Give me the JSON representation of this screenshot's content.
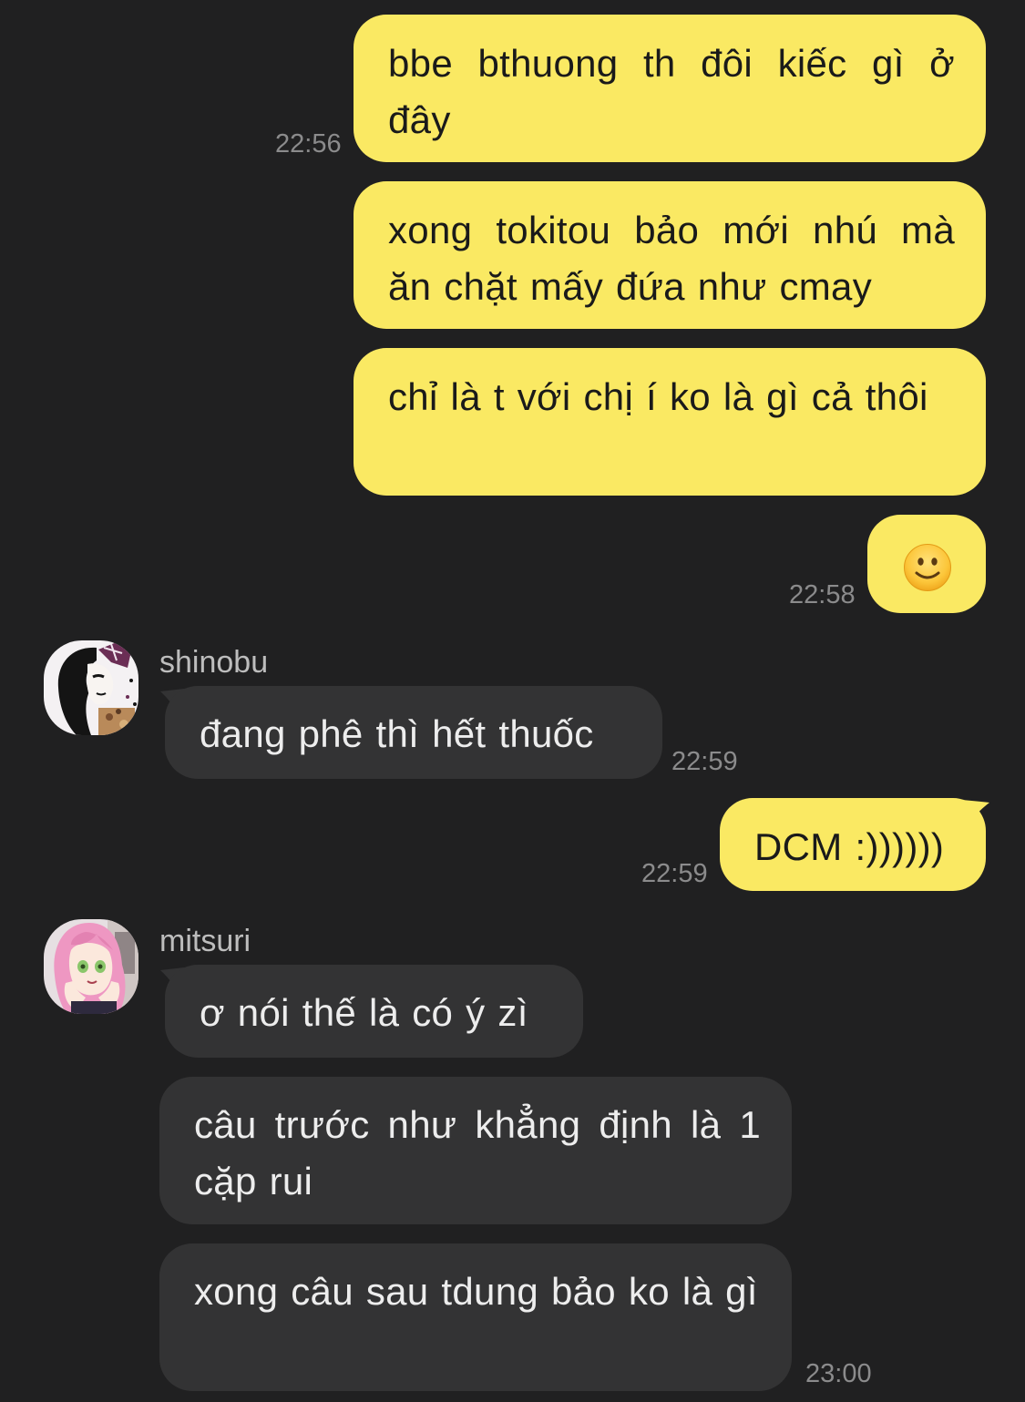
{
  "messages": [
    {
      "id": "m1",
      "text": "bbe bthuong th đôi kiếc gì ở đây",
      "time": "22:56"
    },
    {
      "id": "m2",
      "text": "xong tokitou bảo mới nhú mà ăn chặt mấy đứa như cmay"
    },
    {
      "id": "m3",
      "text": "chỉ là t với chị í ko là gì cả thôi"
    },
    {
      "id": "m4",
      "emoji": "slightly-smiling-face",
      "time": "22:58"
    },
    {
      "id": "m5",
      "sender": "shinobu",
      "text": "đang phê thì hết thuốc",
      "time": "22:59"
    },
    {
      "id": "m6",
      "text": "DCM :))))))",
      "time": "22:59"
    },
    {
      "id": "m7",
      "sender": "mitsuri",
      "text": "ơ nói thế là có ý zì"
    },
    {
      "id": "m8",
      "text": "câu trước như khẳng định là 1 cặp rui"
    },
    {
      "id": "m9",
      "text": "xong câu sau tdung bảo ko là gì",
      "time": "23:00"
    }
  ],
  "colors": {
    "background": "#202021",
    "outgoing_bubble": "#fae963",
    "incoming_bubble": "#333334",
    "timestamp": "#8b8b8c",
    "sender_name": "#bdbdbd"
  }
}
